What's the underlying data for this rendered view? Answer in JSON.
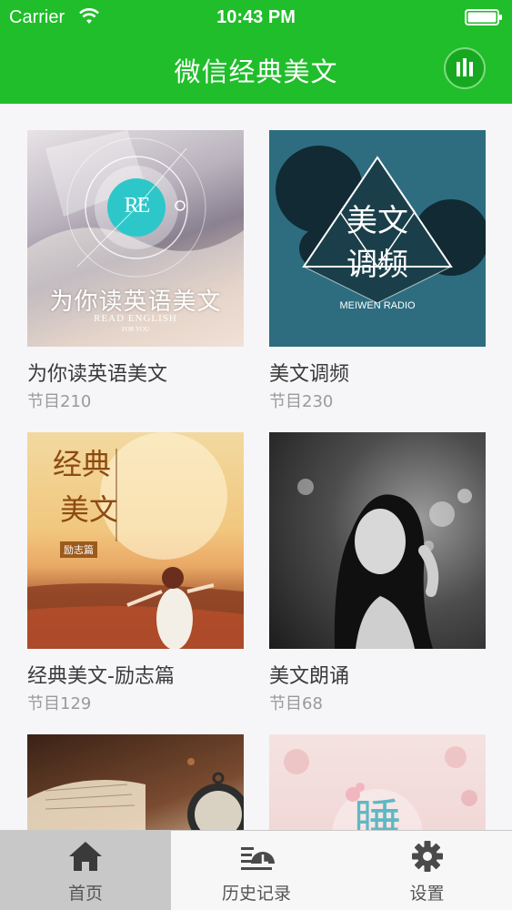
{
  "status_bar": {
    "carrier": "Carrier",
    "time": "10:43 PM"
  },
  "nav": {
    "title": "微信经典美文",
    "player_icon": "equalizer-icon"
  },
  "count_prefix": "节目",
  "albums": [
    {
      "title": "为你读英语美文",
      "count": "210",
      "cover": {
        "lines": [
          "为你读英语美文"
        ],
        "sub": [
          "READ ENGLISH",
          "FOR YOU"
        ],
        "logo": "RE"
      }
    },
    {
      "title": "美文调频",
      "count": "230",
      "cover": {
        "lines": [
          "美文",
          "调频"
        ],
        "sub": [
          "MEIWEN RADIO"
        ]
      }
    },
    {
      "title": "经典美文-励志篇",
      "count": "129",
      "cover": {
        "lines": [
          "经典",
          "美文"
        ],
        "sub": [
          "励志篇"
        ]
      }
    },
    {
      "title": "美文朗诵",
      "count": "68",
      "cover": {}
    },
    {
      "title": "",
      "count": "",
      "cover": {}
    },
    {
      "title": "",
      "count": "",
      "cover": {
        "logo": "睡"
      }
    }
  ],
  "tabs": [
    {
      "label": "首页",
      "icon": "home-icon",
      "active": true
    },
    {
      "label": "历史记录",
      "icon": "history-icon",
      "active": false
    },
    {
      "label": "设置",
      "icon": "gear-icon",
      "active": false
    }
  ],
  "colors": {
    "accent": "#1fbe2a",
    "tab_active_bg": "#c8c8c8"
  }
}
